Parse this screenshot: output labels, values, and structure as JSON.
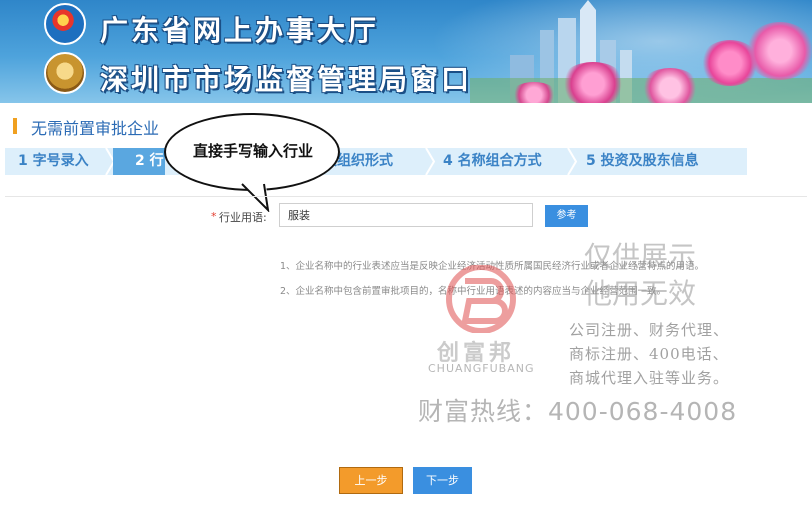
{
  "banner": {
    "title_top": "广东省网上办事大厅",
    "title_bottom": "深圳市市场监督管理局窗口"
  },
  "section": {
    "title": "无需前置审批企业"
  },
  "steps": [
    {
      "label": "1 字号录入",
      "active": false
    },
    {
      "label": "2 行",
      "active": true
    },
    {
      "label": "及组织形式",
      "active": false
    },
    {
      "label": "4 名称组合方式",
      "active": false
    },
    {
      "label": "5 投资及股东信息",
      "active": false
    }
  ],
  "annotation": {
    "bubble_text": "直接手写输入行业"
  },
  "form": {
    "required_mark": "*",
    "industry_label": "行业用语:",
    "industry_value": "服装",
    "reference_button": "参考"
  },
  "notes": [
    "1、企业名称中的行业表述应当是反映企业经济活动性质所属国民经济行业或者企业经营特点的用语。",
    "2、企业名称中包含前置审批项目的，名称中行业用语表述的内容应当与企业经营范围一致。"
  ],
  "watermark": {
    "brand_cn": "创富邦",
    "brand_en": "CHUANGFUBANG",
    "display_line1": "仅供展示",
    "display_line2": "他用无效",
    "service_line1": "公司注册、财务代理、",
    "service_line2": "商标注册、400电话、",
    "service_line3": "商城代理入驻等业务。",
    "hotline": "财富热线：400-068-4008"
  },
  "nav": {
    "prev_button": "上一步",
    "next_button": "下一步"
  },
  "colors": {
    "accent_blue": "#3a8fe0",
    "step_bar": "#ddeffb",
    "step_active": "#5aa7e0",
    "prev_orange": "#f39b2b",
    "title_blue": "#2b6bb5",
    "section_marker": "#f0a020"
  }
}
